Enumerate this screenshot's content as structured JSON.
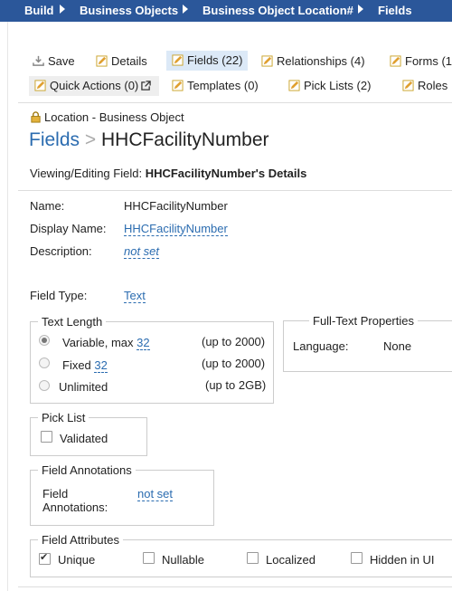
{
  "breadcrumb": [
    "Build",
    "Business Objects",
    "Business Object Location#",
    "Fields"
  ],
  "toolbar": {
    "row1": [
      {
        "label": "Save",
        "icon": "save-icon"
      },
      {
        "label": "Details",
        "icon": "pencil-icon"
      },
      {
        "label": "Fields (22)",
        "icon": "pencil-icon",
        "active": true
      },
      {
        "label": "Relationships (4)",
        "icon": "pencil-icon"
      },
      {
        "label": "Forms (1",
        "icon": "pencil-icon"
      }
    ],
    "row2": [
      {
        "label": "Quick Actions (0)",
        "icon": "pencil-icon",
        "external": true
      },
      {
        "label": "Templates (0)",
        "icon": "pencil-icon"
      },
      {
        "label": "Pick Lists (2)",
        "icon": "pencil-icon"
      },
      {
        "label": "Roles",
        "icon": "pencil-icon"
      }
    ]
  },
  "context": {
    "label": "Location - Business Object",
    "icon": "lock-icon"
  },
  "title": {
    "section": "Fields",
    "separator": ">",
    "name": "HHCFacilityNumber"
  },
  "subtitle": {
    "prefix": "Viewing/Editing Field:",
    "value": "HHCFacilityNumber's Details"
  },
  "props": {
    "name_label": "Name:",
    "name_value": "HHCFacilityNumber",
    "display_label": "Display Name:",
    "display_value": "HHCFacilityNumber",
    "desc_label": "Description:",
    "desc_value": "not set",
    "type_label": "Field Type:",
    "type_value": "Text"
  },
  "text_length": {
    "legend": "Text Length",
    "options": [
      {
        "label": "Variable, max",
        "value": "32",
        "hint": "(up to 2000)",
        "selected": true
      },
      {
        "label": "Fixed",
        "value": "32",
        "hint": "(up to 2000)",
        "selected": false
      },
      {
        "label": "Unlimited",
        "value": "",
        "hint": "(up to 2GB)",
        "selected": false
      }
    ]
  },
  "fulltext": {
    "legend": "Full-Text Properties",
    "language_label": "Language:",
    "language_value": "None"
  },
  "picklist": {
    "legend": "Pick List",
    "validated_label": "Validated",
    "validated": false
  },
  "annotations": {
    "legend": "Field Annotations",
    "label_line1": "Field",
    "label_line2": "Annotations:",
    "value": "not set"
  },
  "attributes": {
    "legend": "Field Attributes",
    "items": [
      {
        "label": "Unique",
        "checked": true
      },
      {
        "label": "Nullable",
        "checked": false
      },
      {
        "label": "Localized",
        "checked": false
      },
      {
        "label": "Hidden in UI",
        "checked": false
      }
    ]
  }
}
